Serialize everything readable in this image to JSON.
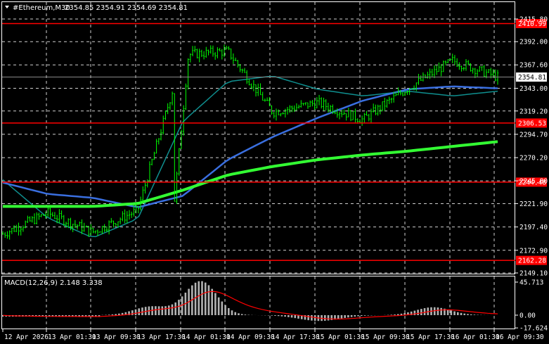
{
  "header": {
    "symbol": "#Ethereum,M30",
    "ohlc": "2354.85 2354.91 2354.69 2354.81"
  },
  "price_axis": {
    "ticks": [
      "2415.80",
      "2392.00",
      "2367.60",
      "2343.00",
      "2319.20",
      "2294.70",
      "2270.20",
      "2245.80",
      "2221.90",
      "2197.40",
      "2172.90",
      "2149.10"
    ],
    "current": "2354.81"
  },
  "levels": [
    {
      "label": "2410.99",
      "value": 2410.99
    },
    {
      "label": "2306.53",
      "value": 2306.53
    },
    {
      "label": "2244.48",
      "value": 2244.48
    },
    {
      "label": "2162.28",
      "value": 2162.28
    }
  ],
  "macd": {
    "label": "MACD(12,26,9) 2.148 3.338",
    "ticks": [
      "45.713",
      "0.00",
      "-17.624"
    ]
  },
  "time_axis": [
    "12 Apr 2026",
    "13 Apr 01:30",
    "13 Apr 09:30",
    "13 Apr 17:30",
    "14 Apr 01:30",
    "14 Apr 09:30",
    "14 Apr 17:30",
    "15 Apr 01:30",
    "15 Apr 09:30",
    "15 Apr 17:30",
    "16 Apr 01:30",
    "16 Apr 09:30"
  ],
  "colors": {
    "candle": "#00ff00",
    "level": "#ff0000",
    "ma_fast": "#0f8f8f",
    "ma_mid": "#3a6fe0",
    "ma_slow": "#33ff33",
    "macd_hist": "#b3b3b3",
    "macd_signal": "#ff0000"
  },
  "chart_data": {
    "type": "line",
    "x": [
      "12 Apr 2026",
      "13 Apr 01:30",
      "13 Apr 09:30",
      "13 Apr 17:30",
      "14 Apr 01:30",
      "14 Apr 09:30",
      "14 Apr 17:30",
      "15 Apr 01:30",
      "15 Apr 09:30",
      "15 Apr 17:30",
      "16 Apr 01:30",
      "16 Apr 09:30"
    ],
    "close": [
      2190,
      2212,
      2192,
      2215,
      2378,
      2382,
      2318,
      2328,
      2310,
      2343,
      2372,
      2354.81
    ],
    "ma_fast": [
      2247,
      2207,
      2186,
      2206,
      2308,
      2350,
      2356,
      2342,
      2335,
      2340,
      2335,
      2340
    ],
    "ma_mid": [
      2244,
      2232,
      2228,
      2218,
      2230,
      2268,
      2292,
      2312,
      2330,
      2342,
      2345,
      2343
    ],
    "ma_slow": [
      2219,
      2219,
      2219,
      2222,
      2236,
      2252,
      2261,
      2268,
      2273,
      2277,
      2282,
      2287
    ],
    "ylim": [
      2149.1,
      2415.8
    ]
  }
}
